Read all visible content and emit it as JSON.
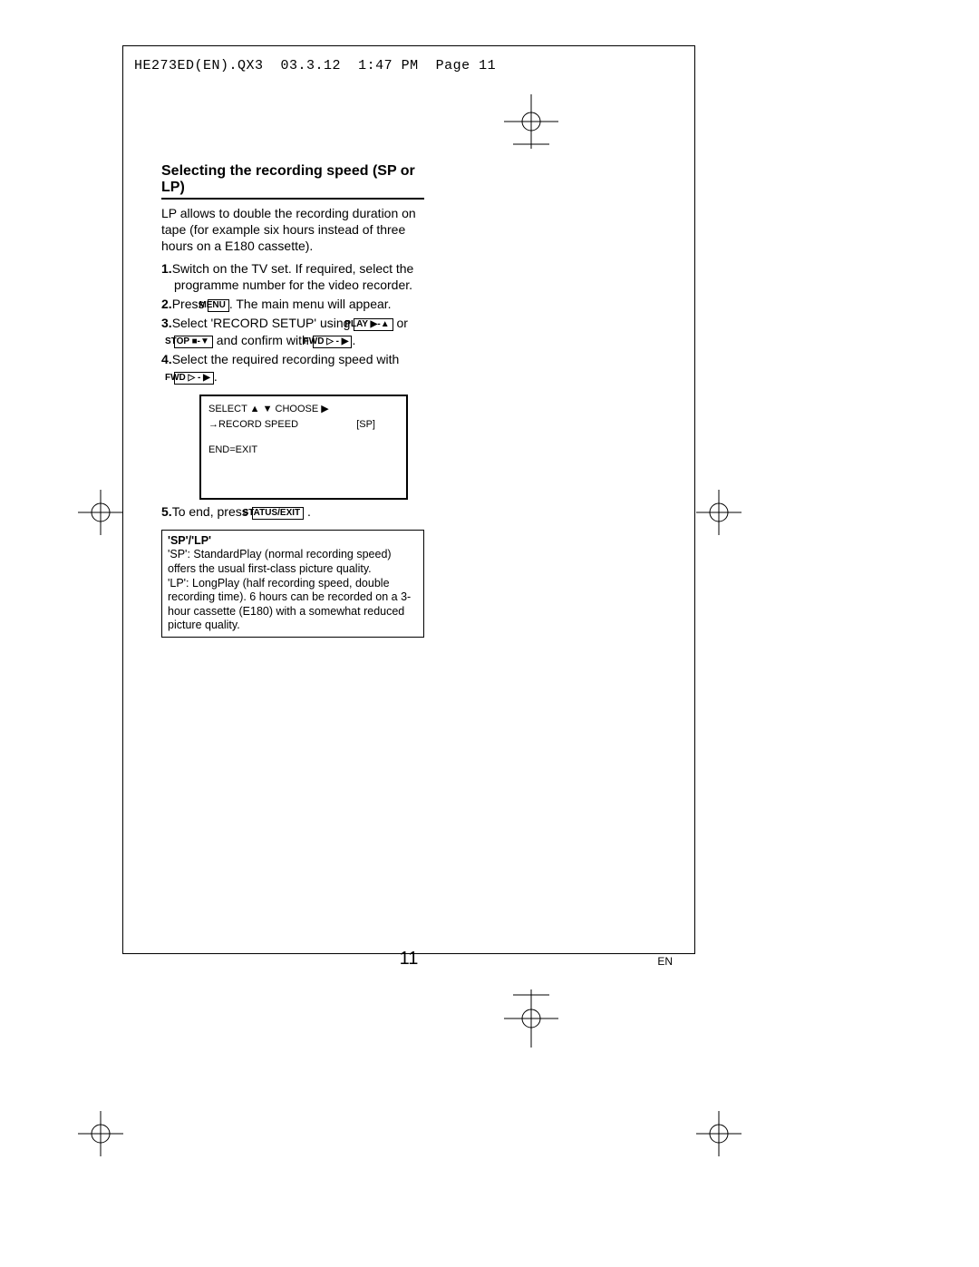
{
  "header": {
    "doc_id": "HE273ED(EN).QX3",
    "date": "03.3.12",
    "time": "1:47 PM",
    "page_label": "Page 11"
  },
  "section": {
    "title": "Selecting the recording speed (SP or LP)",
    "intro": "LP allows to double the recording duration on tape (for example six hours instead of three hours on a E180 cassette)."
  },
  "steps": {
    "s1": {
      "num": "1.",
      "text": "Switch on the TV set. If required, select the programme number for the video recorder."
    },
    "s2": {
      "num": "2.",
      "pre": "Press ",
      "key": "MENU",
      "post": ". The main menu will appear."
    },
    "s3": {
      "num": "3.",
      "pre": "Select 'RECORD SETUP' using ",
      "key1": "PLAY ▶-▲",
      "mid1": " or ",
      "key2": "STOP ■-▼",
      "mid2": " and confirm with ",
      "key3": "FWD ▷ - ▶",
      "post": "."
    },
    "s4": {
      "num": "4.",
      "pre": "Select the required recording speed with ",
      "key": "FWD ▷ - ▶",
      "post": "."
    },
    "s5": {
      "num": "5.",
      "pre": "To end, press ",
      "key": "STATUS/EXIT",
      "post": " ."
    }
  },
  "osd": {
    "row1": "SELECT ▲ ▼  CHOOSE ▶",
    "row2_label": "→RECORD SPEED",
    "row2_value": "[SP]",
    "exit": "END=EXIT"
  },
  "infobox": {
    "title": "'SP'/'LP'",
    "body": "'SP': StandardPlay (normal recording speed) offers the usual first-class picture quality.\n'LP': LongPlay (half recording speed, double recording time). 6 hours can be recorded on a 3-hour cassette (E180) with a somewhat reduced picture quality."
  },
  "footer": {
    "page_number": "11",
    "lang": "EN"
  }
}
